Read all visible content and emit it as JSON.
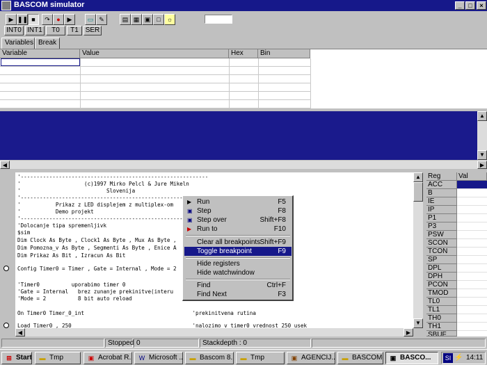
{
  "window": {
    "title": "BASCOM simulator"
  },
  "toolbar": {
    "interrupt_buttons": [
      "INT0",
      "INT1",
      "T0",
      "T1",
      "SER"
    ]
  },
  "tabs": [
    "Variables",
    "Break"
  ],
  "variables_table": {
    "columns": [
      "Variable",
      "Value",
      "Hex",
      "Bin"
    ],
    "rows": []
  },
  "code_lines": [
    "'-----------------------------------------------------------",
    "'                    (c)1997 Mirko Pelcl & Jure Mikeln",
    "'                           Slovenija",
    "'-----------------------------------------------------------",
    "'           Prikaz z LED displejem z multiplex-om",
    "'           Demo projekt",
    "'-----------------------------------------------------------",
    "'Dolocanje tipa spremenljivk",
    "$sim",
    "Dim Clock As Byte , Clock1 As Byte , Mux As Byte ,",
    "Dim Pomozna_v As Byte , Segmenti As Byte , Enice A",
    "Dim Prikaz As Bit , Izracun As Bit",
    "",
    "Config Timer0 = Timer , Gate = Internal , Mode = 2",
    "",
    "'Timer0          uporabimo timer 0",
    "'Gate = Internal   brez zunanje prekinitve(interu",
    "'Mode = 2          8 bit auto reload",
    "",
    "On Timer0 Timer_0_int                                  'prekinitvena rutina",
    "",
    "Load Timer0 , 250                                      'nalozimo v timer0 vrednost 250 usek"
  ],
  "context_menu": {
    "items": [
      {
        "label": "Run",
        "shortcut": "F5",
        "icon": "play-icon"
      },
      {
        "label": "Step",
        "shortcut": "F8",
        "icon": "step-icon"
      },
      {
        "label": "Step over",
        "shortcut": "Shift+F8",
        "icon": "step-over-icon"
      },
      {
        "label": "Run to",
        "shortcut": "F10",
        "icon": "run-to-icon"
      },
      {
        "label": "Clear all breakpoints",
        "shortcut": "Shift+F9",
        "icon": ""
      },
      {
        "label": "Toggle breakpoint",
        "shortcut": "F9",
        "icon": "",
        "highlighted": true
      },
      {
        "label": "Hide registers",
        "shortcut": "",
        "icon": ""
      },
      {
        "label": "Hide watchwindow",
        "shortcut": "",
        "icon": ""
      },
      {
        "label": "Find",
        "shortcut": "Ctrl+F",
        "icon": ""
      },
      {
        "label": "Find Next",
        "shortcut": "F3",
        "icon": ""
      }
    ]
  },
  "registers": {
    "columns": [
      "Reg",
      "Val"
    ],
    "names": [
      "ACC",
      "B",
      "IE",
      "IP",
      "P1",
      "P3",
      "PSW",
      "SCON",
      "TCON",
      "SP",
      "DPL",
      "DPH",
      "PCON",
      "TMOD",
      "TL0",
      "TL1",
      "TH0",
      "TH1",
      "SBUF"
    ]
  },
  "status": {
    "state": "Stopped",
    "state_value": "0",
    "stackdepth": "Stackdepth : 0"
  },
  "taskbar": {
    "start": "Start",
    "tasks": [
      "Tmp",
      "Acrobat R...",
      "Microsoft ...",
      "Bascom 8...",
      "Tmp",
      "AGENCIJ...",
      "BASCOM-...",
      "BASCO..."
    ],
    "tray_lang": "SI",
    "clock": "14:11"
  },
  "colors": {
    "title_bar": "#16188a",
    "blue_pane": "#1a1a8c",
    "selection": "#16188a",
    "window_face": "#c0c0c0"
  }
}
